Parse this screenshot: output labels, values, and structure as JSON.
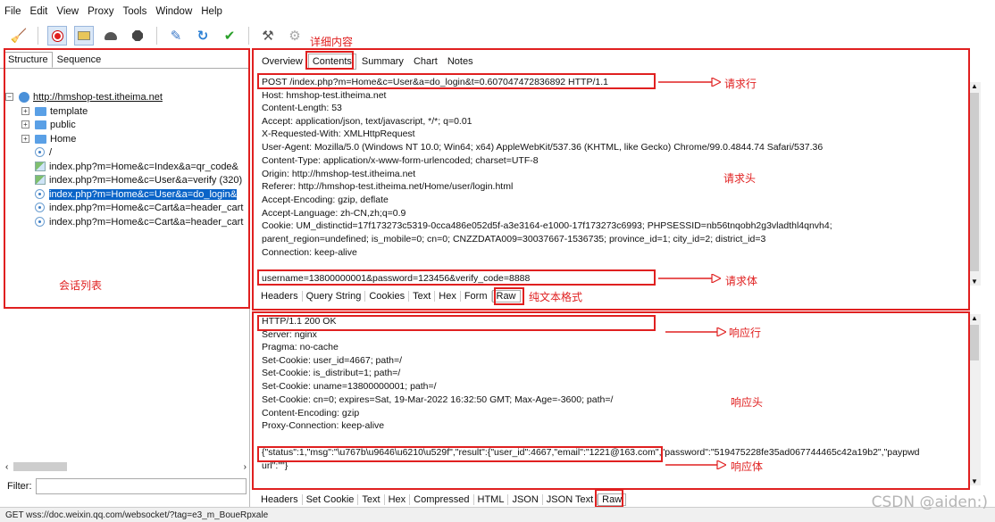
{
  "menu": [
    "File",
    "Edit",
    "View",
    "Proxy",
    "Tools",
    "Window",
    "Help"
  ],
  "toolbar_icons": [
    "broom-icon",
    "record-icon",
    "throttle-icon",
    "turtle-icon",
    "stop-icon",
    "pen-icon",
    "refresh-icon",
    "check-icon",
    "tools-icon",
    "gear-icon"
  ],
  "left_tabs": [
    "Structure",
    "Sequence"
  ],
  "tree": [
    {
      "label": "http://hmshop-test.itheima.net",
      "type": "host",
      "indent": 0
    },
    {
      "label": "template",
      "type": "folder",
      "indent": 1
    },
    {
      "label": "public",
      "type": "folder",
      "indent": 1
    },
    {
      "label": "Home",
      "type": "folder",
      "indent": 1
    },
    {
      "label": "/",
      "type": "page",
      "indent": 1
    },
    {
      "label": "index.php?m=Home&c=Index&a=qr_code&",
      "type": "image",
      "indent": 1
    },
    {
      "label": "index.php?m=Home&c=User&a=verify (320)",
      "type": "image",
      "indent": 1
    },
    {
      "label": "index.php?m=Home&c=User&a=do_login&",
      "type": "page",
      "indent": 1,
      "selected": true
    },
    {
      "label": "index.php?m=Home&c=Cart&a=header_cart",
      "type": "page",
      "indent": 1
    },
    {
      "label": "index.php?m=Home&c=Cart&a=header_cart",
      "type": "page",
      "indent": 1
    }
  ],
  "filter_label": "Filter:",
  "status_text": "GET wss://doc.weixin.qq.com/websocket/?tag=e3_m_BoueRpxale",
  "right_tabs": [
    "Overview",
    "Contents",
    "Summary",
    "Chart",
    "Notes"
  ],
  "request_lines": [
    "POST /index.php?m=Home&c=User&a=do_login&t=0.607047472836892 HTTP/1.1",
    "Host: hmshop-test.itheima.net",
    "Content-Length: 53",
    "Accept: application/json, text/javascript, */*; q=0.01",
    "X-Requested-With: XMLHttpRequest",
    "User-Agent: Mozilla/5.0 (Windows NT 10.0; Win64; x64) AppleWebKit/537.36 (KHTML, like Gecko) Chrome/99.0.4844.74 Safari/537.36",
    "Content-Type: application/x-www-form-urlencoded; charset=UTF-8",
    "Origin: http://hmshop-test.itheima.net",
    "Referer: http://hmshop-test.itheima.net/Home/user/login.html",
    "Accept-Encoding: gzip, deflate",
    "Accept-Language: zh-CN,zh;q=0.9",
    "Cookie: UM_distinctid=17f173273c5319-0cca486e052d5f-a3e3164-e1000-17f173273c6993; PHPSESSID=nb56tnqobh2g3vladthl4qnvh4;",
    "parent_region=undefined; is_mobile=0; cn=0; CNZZDATA009=30037667-1536735; province_id=1; city_id=2; district_id=3",
    "Connection: keep-alive"
  ],
  "request_body": "username=13800000001&password=123456&verify_code=8888",
  "request_tabs": [
    "Headers",
    "Query String",
    "Cookies",
    "Text",
    "Hex",
    "Form",
    "Raw"
  ],
  "response_lines": [
    "HTTP/1.1 200 OK",
    "Server: nginx",
    "Pragma: no-cache",
    "Set-Cookie: user_id=4667; path=/",
    "Set-Cookie: is_distribut=1; path=/",
    "Set-Cookie: uname=13800000001; path=/",
    "Set-Cookie: cn=0; expires=Sat, 19-Mar-2022 16:32:50 GMT; Max-Age=-3600; path=/",
    "Content-Encoding: gzip",
    "Proxy-Connection: keep-alive"
  ],
  "response_body": "{\"status\":1,\"msg\":\"\\u767b\\u9646\\u6210\\u529f\",\"result\":{\"user_id\":4667,\"email\":\"1221@163.com\",\"password\":\"519475228fe35ad067744465c42a19b2\",\"paypwd",
  "response_body_tail": "url\":\"\"}",
  "response_tabs": [
    "Headers",
    "Set Cookie",
    "Text",
    "Hex",
    "Compressed",
    "HTML",
    "JSON",
    "JSON Text",
    "Raw"
  ],
  "annotations": {
    "detail": "详细内容",
    "session_list": "会话列表",
    "req_line": "请求行",
    "req_head": "请求头",
    "req_body": "请求体",
    "plain_text": "纯文本格式",
    "resp_line": "响应行",
    "resp_head": "响应头",
    "resp_body": "响应体"
  },
  "watermark": "CSDN @aiden:)",
  "colors": {
    "annotation": "#e02020",
    "selection": "#0a64c8"
  }
}
